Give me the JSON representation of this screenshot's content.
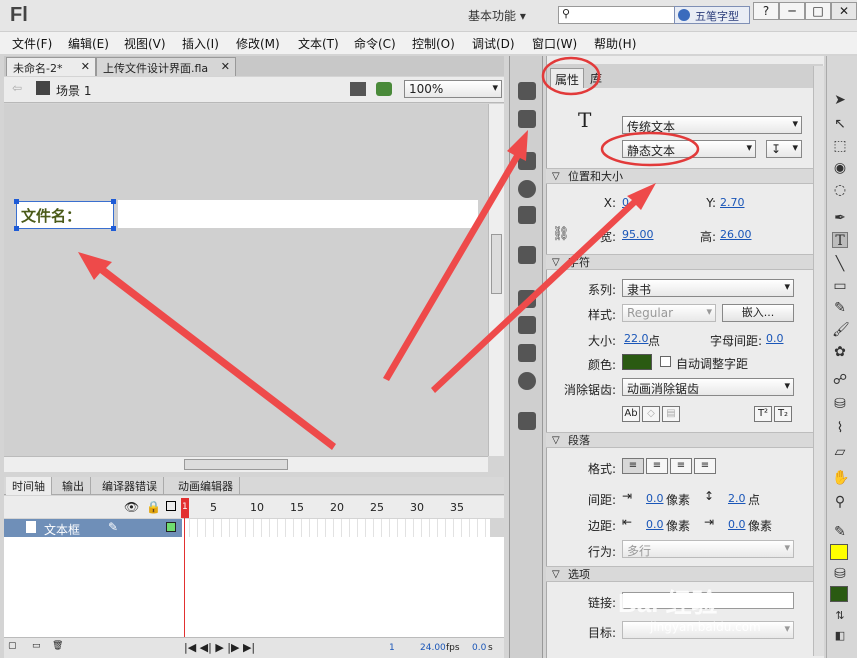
{
  "app": {
    "logo": "Fl",
    "workspace": "基本功能",
    "ime_label": "五笔字型",
    "window_buttons": [
      "?",
      "─",
      "□",
      "✕"
    ]
  },
  "menubar": [
    "文件(F)",
    "编辑(E)",
    "视图(V)",
    "插入(I)",
    "修改(M)",
    "文本(T)",
    "命令(C)",
    "控制(O)",
    "调试(D)",
    "窗口(W)",
    "帮助(H)"
  ],
  "doc_tabs": [
    "未命名-2*",
    "上传文件设计界面.fla"
  ],
  "docbar": {
    "scene": "场景 1",
    "zoom": "100%"
  },
  "stage": {
    "textbox_text": "文件名："
  },
  "timeline": {
    "tabs": [
      "时间轴",
      "输出",
      "编译器错误",
      "动画编辑器"
    ],
    "frame_numbers": [
      "1",
      "5",
      "10",
      "15",
      "20",
      "25",
      "30",
      "35"
    ],
    "layer_name": "文本框",
    "footer": {
      "current_frame": "1",
      "fps": "24.00",
      "fps_unit": "fps",
      "time": "0.0",
      "time_unit": "s"
    }
  },
  "props": {
    "tabs": [
      "属性",
      "库"
    ],
    "tool_glyph": "T",
    "text_engine": "传统文本",
    "text_type": "静态文本",
    "section_position": "位置和大小",
    "x_label": "X:",
    "x_value": "0",
    "y_label": "Y:",
    "y_value": "2.70",
    "w_label": "宽:",
    "w_value": "95.00",
    "h_label": "高:",
    "h_value": "26.00",
    "section_char": "字符",
    "family_label": "系列:",
    "family_value": "隶书",
    "style_label": "样式:",
    "style_value": "Regular",
    "embed_label": "嵌入...",
    "size_label": "大小:",
    "size_value": "22.0",
    "size_unit": "点",
    "spacing_label": "字母间距:",
    "spacing_value": "0.0",
    "color_label": "颜色:",
    "color_value": "#2a5a12",
    "auto_kern_label": "自动调整字距",
    "aa_label": "消除锯齿:",
    "aa_value": "动画消除锯齿",
    "section_para": "段落",
    "format_label": "格式:",
    "spacing2_label": "间距:",
    "indent_value": "0.0",
    "indent_unit": "像素",
    "line_value": "2.0",
    "line_unit": "点",
    "margin_label": "边距:",
    "margin_left": "0.0",
    "margin_left_unit": "像素",
    "margin_right": "0.0",
    "margin_right_unit": "像素",
    "behavior_label": "行为:",
    "behavior_value": "多行",
    "section_options": "选项",
    "link_label": "链接:",
    "target_label": "目标:"
  },
  "watermark": {
    "main": "Bai 经验",
    "sub": "jingyan.baidu.com"
  },
  "colors": {
    "accent": "#e23a3a",
    "fill_color": "#ffff00",
    "stroke_color": "#2a5a12"
  }
}
